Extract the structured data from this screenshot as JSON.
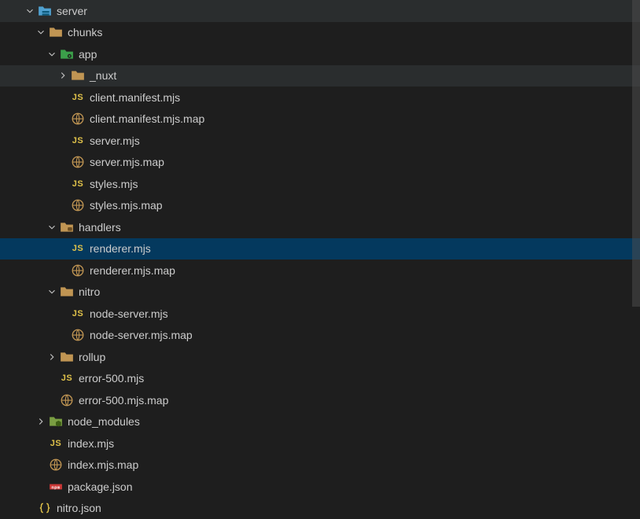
{
  "tree": [
    {
      "depth": 0,
      "kind": "folder",
      "icon": "folder-server",
      "chev": "down",
      "label": "server"
    },
    {
      "depth": 1,
      "kind": "folder",
      "icon": "folder",
      "chev": "down",
      "label": "chunks"
    },
    {
      "depth": 2,
      "kind": "folder",
      "icon": "folder-app",
      "chev": "down",
      "label": "app"
    },
    {
      "depth": 3,
      "kind": "folder",
      "icon": "folder",
      "chev": "right",
      "label": "_nuxt",
      "hover": true
    },
    {
      "depth": 3,
      "kind": "file",
      "icon": "js",
      "label": "client.manifest.mjs"
    },
    {
      "depth": 3,
      "kind": "file",
      "icon": "map",
      "label": "client.manifest.mjs.map"
    },
    {
      "depth": 3,
      "kind": "file",
      "icon": "js",
      "label": "server.mjs"
    },
    {
      "depth": 3,
      "kind": "file",
      "icon": "map",
      "label": "server.mjs.map"
    },
    {
      "depth": 3,
      "kind": "file",
      "icon": "js",
      "label": "styles.mjs"
    },
    {
      "depth": 3,
      "kind": "file",
      "icon": "map",
      "label": "styles.mjs.map"
    },
    {
      "depth": 2,
      "kind": "folder",
      "icon": "folder-hdl",
      "chev": "down",
      "label": "handlers"
    },
    {
      "depth": 3,
      "kind": "file",
      "icon": "js",
      "label": "renderer.mjs",
      "selected": true
    },
    {
      "depth": 3,
      "kind": "file",
      "icon": "map",
      "label": "renderer.mjs.map"
    },
    {
      "depth": 2,
      "kind": "folder",
      "icon": "folder",
      "chev": "down",
      "label": "nitro"
    },
    {
      "depth": 3,
      "kind": "file",
      "icon": "js",
      "label": "node-server.mjs"
    },
    {
      "depth": 3,
      "kind": "file",
      "icon": "map",
      "label": "node-server.mjs.map"
    },
    {
      "depth": 2,
      "kind": "folder",
      "icon": "folder",
      "chev": "right",
      "label": "rollup"
    },
    {
      "depth": 2,
      "kind": "file",
      "icon": "js",
      "label": "error-500.mjs"
    },
    {
      "depth": 2,
      "kind": "file",
      "icon": "map",
      "label": "error-500.mjs.map"
    },
    {
      "depth": 1,
      "kind": "folder",
      "icon": "folder-node",
      "chev": "right",
      "label": "node_modules"
    },
    {
      "depth": 1,
      "kind": "file",
      "icon": "js",
      "label": "index.mjs"
    },
    {
      "depth": 1,
      "kind": "file",
      "icon": "map",
      "label": "index.mjs.map"
    },
    {
      "depth": 1,
      "kind": "file",
      "icon": "npm",
      "label": "package.json"
    },
    {
      "depth": 0,
      "kind": "file",
      "icon": "json",
      "label": "nitro.json"
    }
  ]
}
